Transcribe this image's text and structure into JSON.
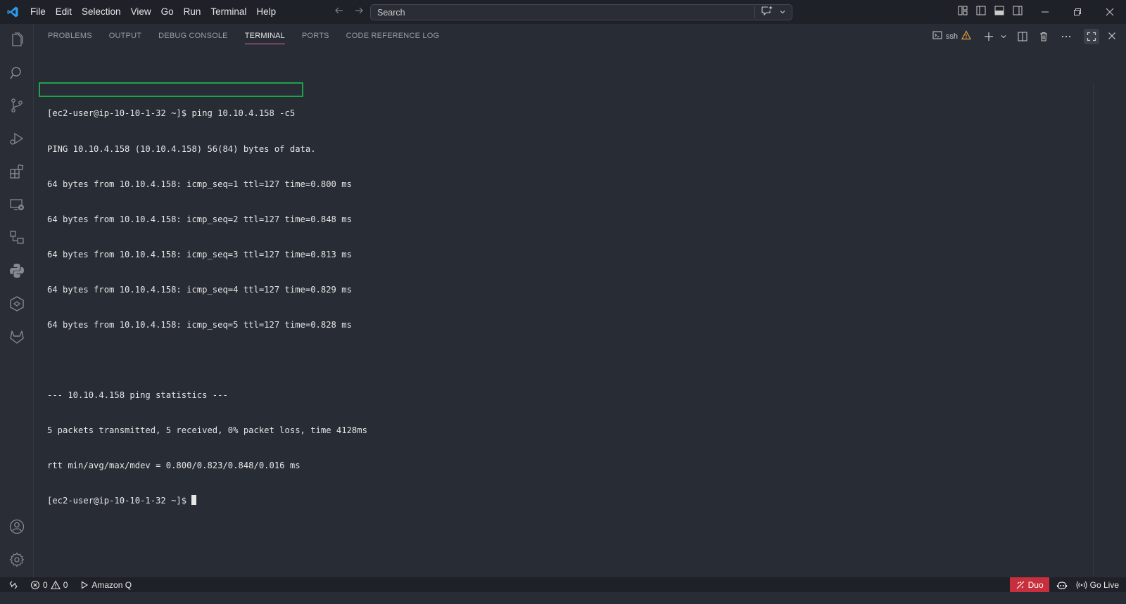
{
  "menu": [
    "File",
    "Edit",
    "Selection",
    "View",
    "Go",
    "Run",
    "Terminal",
    "Help"
  ],
  "search": {
    "placeholder": "Search"
  },
  "panel": {
    "tabs": [
      "PROBLEMS",
      "OUTPUT",
      "DEBUG CONSOLE",
      "TERMINAL",
      "PORTS",
      "CODE REFERENCE LOG"
    ],
    "active_tab": "TERMINAL",
    "terminal_name": "ssh"
  },
  "terminal": {
    "lines": [
      "[ec2-user@ip-10-10-1-32 ~]$ ping 10.10.4.158 -c5",
      "PING 10.10.4.158 (10.10.4.158) 56(84) bytes of data.",
      "64 bytes from 10.10.4.158: icmp_seq=1 ttl=127 time=0.800 ms",
      "64 bytes from 10.10.4.158: icmp_seq=2 ttl=127 time=0.848 ms",
      "64 bytes from 10.10.4.158: icmp_seq=3 ttl=127 time=0.813 ms",
      "64 bytes from 10.10.4.158: icmp_seq=4 ttl=127 time=0.829 ms",
      "64 bytes from 10.10.4.158: icmp_seq=5 ttl=127 time=0.828 ms",
      "",
      "--- 10.10.4.158 ping statistics ---",
      "5 packets transmitted, 5 received, 0% packet loss, time 4128ms",
      "rtt min/avg/max/mdev = 0.800/0.823/0.848/0.016 ms"
    ],
    "prompt": "[ec2-user@ip-10-10-1-32 ~]$ "
  },
  "statusbar": {
    "errors": "0",
    "warnings": "0",
    "amazon_q": "Amazon Q",
    "duo": "Duo",
    "go_live": "Go Live"
  },
  "colors": {
    "highlight": "#1ea24a",
    "accent_tab": "#e36aa1",
    "duo_bg": "#c72f3c",
    "warning": "#e8a33d",
    "vscode_blue": "#2c9cf0"
  }
}
